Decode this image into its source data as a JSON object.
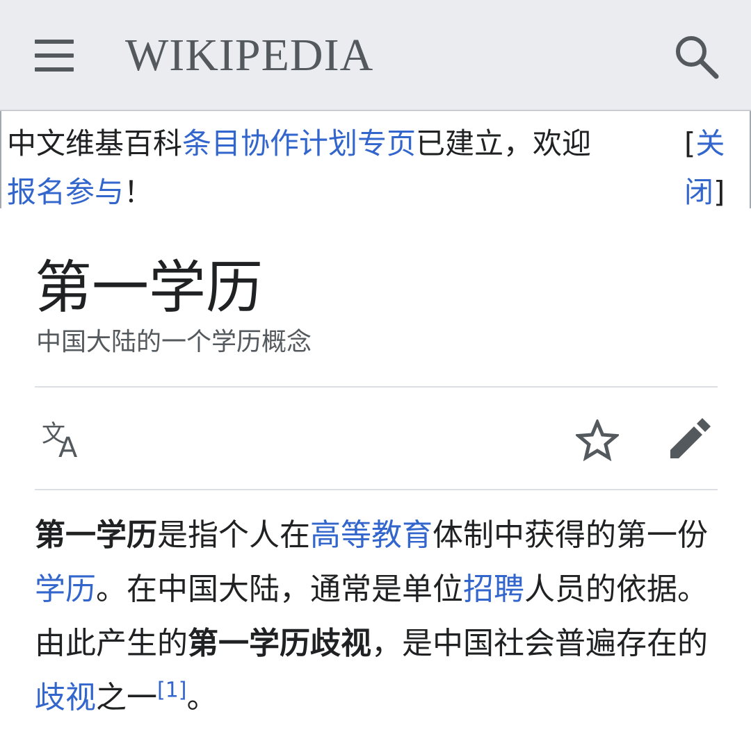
{
  "header": {
    "logo_text": "WIKIPEDIA",
    "menu_icon": "hamburger-menu-icon",
    "search_icon": "search-icon",
    "background": "#eaecf0"
  },
  "banner": {
    "prefix": "中文维基百科",
    "link_text": "条目协作计划专页",
    "middle": "已建立，欢迎",
    "signup_link": "报名参与",
    "suffix": "！",
    "close_open": "[",
    "close_label": "关闭",
    "close_close": "]"
  },
  "article": {
    "title": "第一学历",
    "description": "中国大陆的一个学历概念",
    "actions": {
      "language_icon": "language-translate-icon",
      "watch_icon": "star-icon",
      "edit_icon": "pencil-edit-icon"
    },
    "lead": {
      "term": "第一学历",
      "t1": "是指个人在",
      "link1": "高等教育",
      "t2": "体制中获得的第一份",
      "link2": "学历",
      "t3": "。在中国大陆，通常是单位",
      "link3": "招聘",
      "t4": "人员的依据。由此产生的",
      "bold2": "第一学历歧视",
      "t5": "，是中国社会普遍存在的",
      "link4": "歧视",
      "t6": "之一",
      "ref": "[1]",
      "t7": "。"
    }
  },
  "colors": {
    "link": "#3366cc",
    "text": "#202122",
    "icon": "#54595d"
  }
}
